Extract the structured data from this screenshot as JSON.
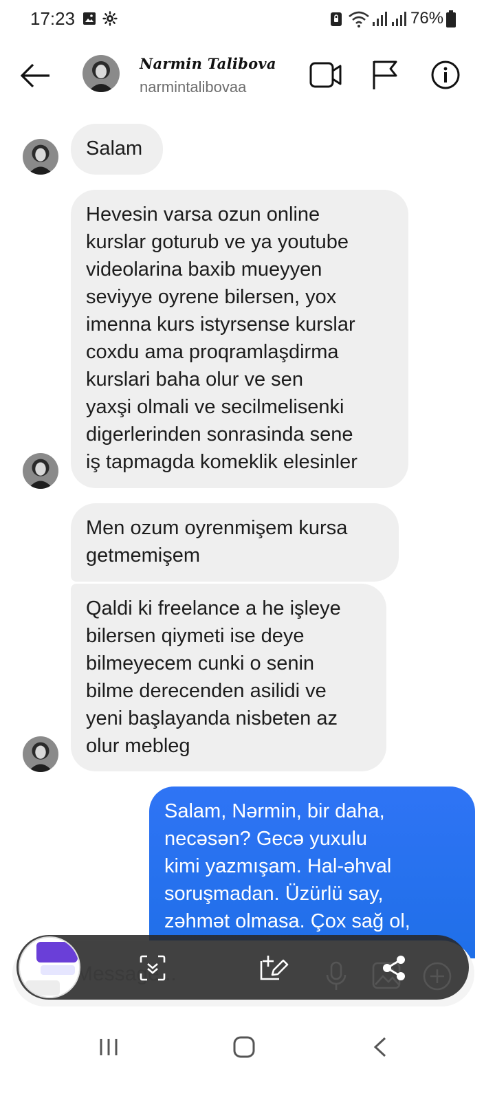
{
  "status_bar": {
    "time": "17:23",
    "battery": "76%",
    "icons": [
      "gallery-icon",
      "settings-icon",
      "lock-icon",
      "wifi-icon",
      "signal-icon",
      "signal-icon",
      "battery-icon"
    ]
  },
  "header": {
    "name": "Narmin Talibova",
    "username": "narmintalibovaa",
    "icons": [
      "back-arrow-icon",
      "video-call-icon",
      "flag-icon",
      "info-icon"
    ]
  },
  "messages": [
    {
      "from": "them",
      "lines": [
        "Salam"
      ]
    },
    {
      "from": "them",
      "lines": [
        "Hevesin varsa ozun online",
        "kurslar goturub ve ya youtube",
        "videolarina baxib mueyyen",
        "seviyye oyrene bilersen, yox",
        "imenna kurs istyrsense kurslar",
        "coxdu ama proqramlaşdirma",
        "kurslari baha olur ve sen",
        "yaxşi olmali ve secilmelisenki",
        "digerlerinden sonrasinda sene",
        "iş tapmagda komeklik elesinler"
      ]
    },
    {
      "from": "them",
      "lines": [
        "Men ozum oyrenmişem kursa",
        "getmemişem"
      ]
    },
    {
      "from": "them",
      "lines": [
        "Qaldi ki freelance a he işleye",
        "bilersen qiymeti ise deye",
        "bilmeyecem cunki o senin",
        "bilme derecenden asilidi ve",
        "yeni başlayanda nisbeten az",
        "olur mebleg"
      ]
    },
    {
      "from": "me",
      "lines": [
        "Salam, Nərmin, bir daha,",
        "necəsən? Gecə yuxulu",
        "kimi yazmışam. Hal-əhval",
        "soruşmadan. Üzürlü say,",
        "zəhmət olmasa. Çox sağ ol,"
      ]
    }
  ],
  "composer": {
    "placeholder": "Message..."
  },
  "screenshot_toolbar": {
    "icons": [
      "scroll-capture-icon",
      "edit-icon",
      "microphone-icon",
      "gallery-icon",
      "share-icon",
      "add-icon"
    ]
  },
  "navbar": {
    "icons": [
      "recent-apps-icon",
      "home-icon",
      "back-icon"
    ]
  },
  "colors": {
    "sent_bubble": "#2874f0",
    "received_bubble": "#efefef",
    "background": "#ffffff"
  }
}
